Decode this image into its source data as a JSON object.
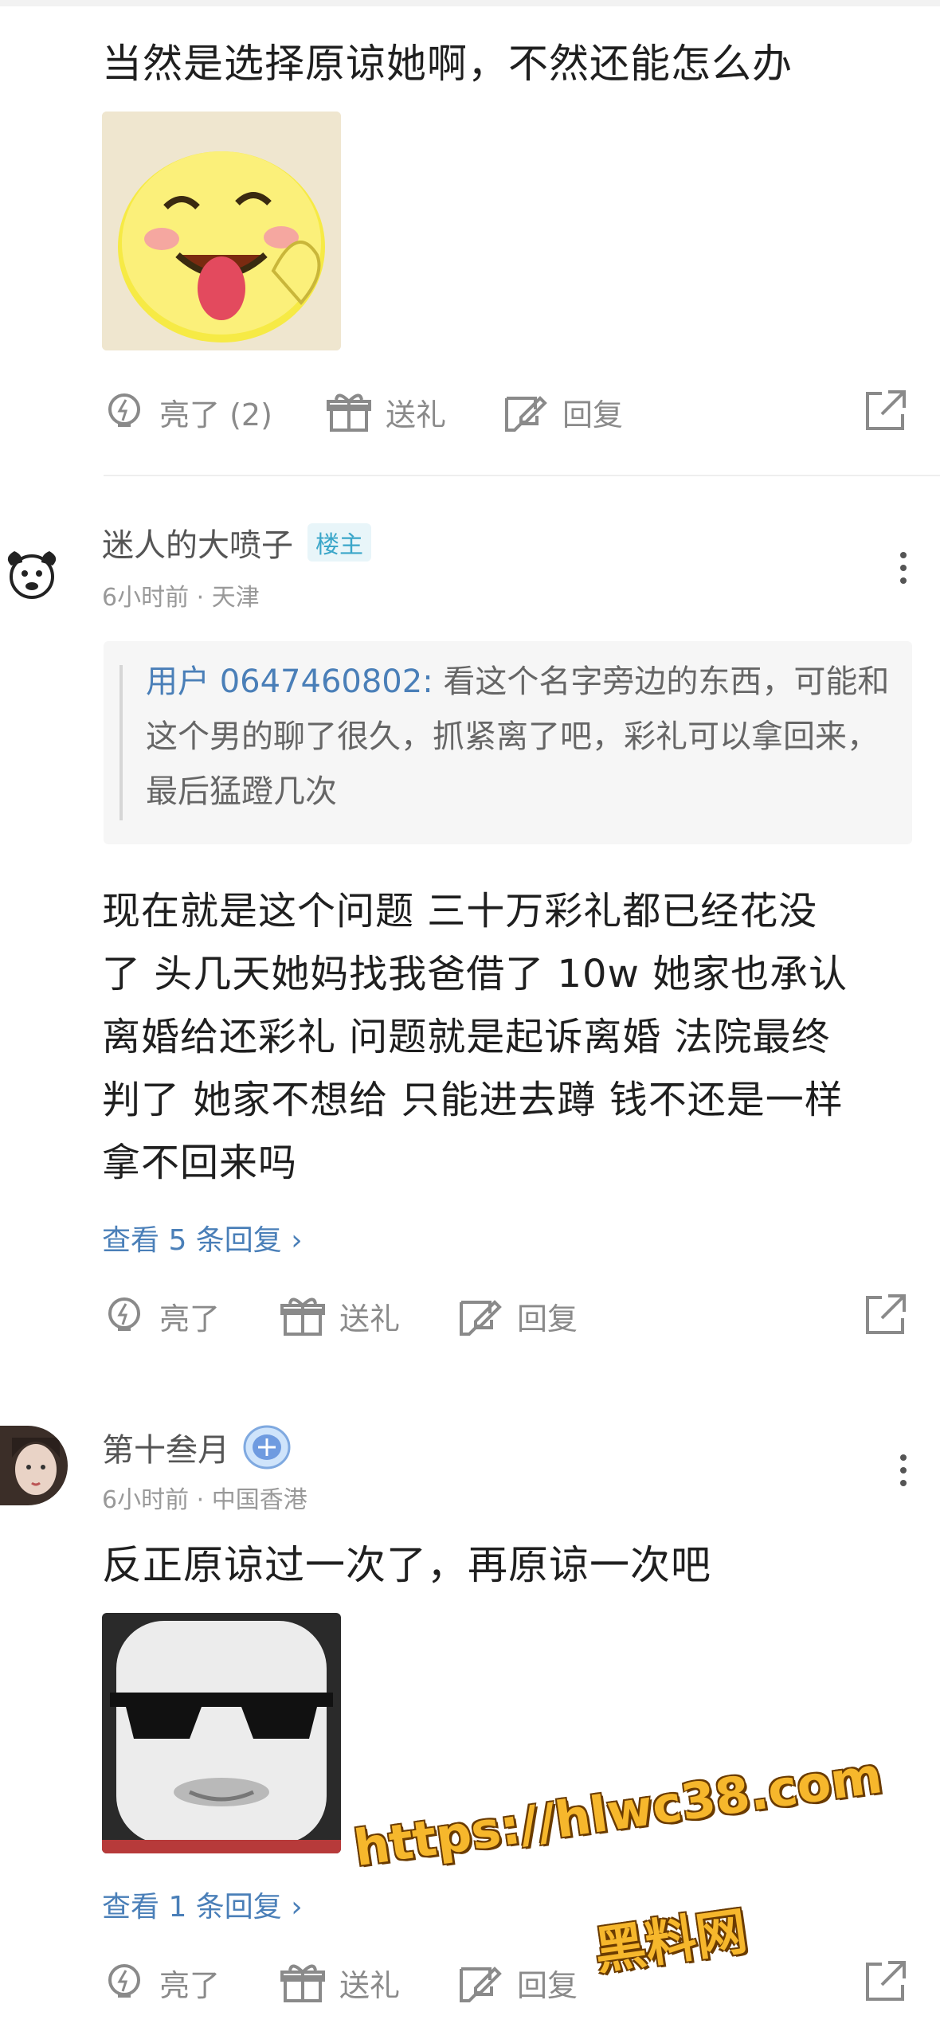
{
  "comment1": {
    "text": "当然是选择原谅她啊，不然还能怎么办",
    "sticker_icon": "laughing-tongue-sticker",
    "actions": {
      "like": "亮了 (2)",
      "gift": "送礼",
      "reply": "回复"
    }
  },
  "comment2": {
    "username": "迷人的大喷子",
    "badge": "楼主",
    "meta": "6小时前 · 天津",
    "quote_user": "用户 0647460802:",
    "quote_text": " 看这个名字旁边的东西，可能和这个男的聊了很久，抓紧离了吧，彩礼可以拿回来，最后猛蹬几次",
    "lines": [
      "现在就是这个问题 三十万彩礼都已经花没",
      "了 头几天她妈找我爸借了 10w 她家也承认",
      "离婚给还彩礼 问题就是起诉离婚 法院最终",
      "判了 她家不想给 只能进去蹲 钱不还是一样",
      "拿不回来吗"
    ],
    "view_replies": "查看 5 条回复 ›",
    "actions": {
      "like": "亮了",
      "gift": "送礼",
      "reply": "回复"
    }
  },
  "comment3": {
    "username": "第十叁月",
    "meta": "6小时前 · 中国香港",
    "text": "反正原谅过一次了，再原谅一次吧",
    "sticker_icon": "sunglasses-face-sticker",
    "view_replies": "查看 1 条回复 ›",
    "actions": {
      "like": "亮了",
      "gift": "送礼",
      "reply": "回复"
    }
  },
  "watermark": {
    "line1": "https://hlwc38.com",
    "line2": "黑料网"
  },
  "colors": {
    "accent_blue": "#4a7fb8",
    "badge_teal": "#3aa6c9",
    "watermark_yellow": "#f6b72c"
  }
}
